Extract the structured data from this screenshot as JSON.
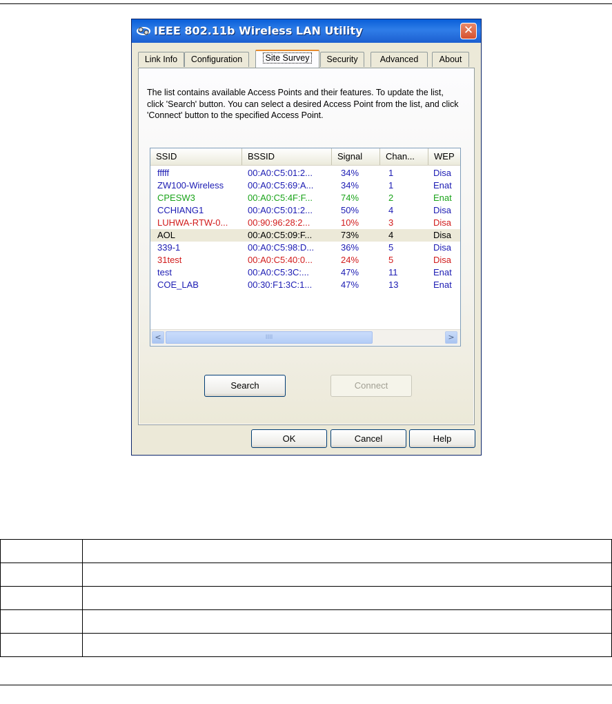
{
  "window": {
    "title": "IEEE 802.11b Wireless LAN Utility",
    "close_glyph": "✕"
  },
  "tabs": [
    {
      "label": "Link Info"
    },
    {
      "label": "Configuration"
    },
    {
      "label": "Site Survey"
    },
    {
      "label": "Security"
    },
    {
      "label": "Advanced"
    },
    {
      "label": "About"
    }
  ],
  "site_survey": {
    "description": "The list contains available Access Points and their features. To update the list, click 'Search' button. You can select a desired Access Point from the list, and click 'Connect' button to the specified Access Point.",
    "columns": [
      "SSID",
      "BSSID",
      "Signal",
      "Chan...",
      "WEP"
    ],
    "rows": [
      {
        "ssid": "fffff",
        "bssid": "00:A0:C5:01:2...",
        "signal": "34%",
        "channel": "1",
        "wep": "Disa",
        "color": "#1b1bb3"
      },
      {
        "ssid": "ZW100-Wireless",
        "bssid": "00:A0:C5:69:A...",
        "signal": "34%",
        "channel": "1",
        "wep": "Enat",
        "color": "#1b1bb3"
      },
      {
        "ssid": "CPESW3",
        "bssid": "00:A0:C5:4F:F...",
        "signal": "74%",
        "channel": "2",
        "wep": "Enat",
        "color": "#19a319"
      },
      {
        "ssid": "CCHIANG1",
        "bssid": "00:A0:C5:01:2...",
        "signal": "50%",
        "channel": "4",
        "wep": "Disa",
        "color": "#1b1bb3"
      },
      {
        "ssid": "LUHWA-RTW-0...",
        "bssid": "00:90:96:28:2...",
        "signal": "10%",
        "channel": "3",
        "wep": "Disa",
        "color": "#d11b1b"
      },
      {
        "ssid": "AOL",
        "bssid": "00:A0:C5:09:F...",
        "signal": "73%",
        "channel": "4",
        "wep": "Disa",
        "color": "#000000"
      },
      {
        "ssid": "339-1",
        "bssid": "00:A0:C5:98:D...",
        "signal": "36%",
        "channel": "5",
        "wep": "Disa",
        "color": "#1b1bb3"
      },
      {
        "ssid": "31test",
        "bssid": "00:A0:C5:40:0...",
        "signal": "24%",
        "channel": "5",
        "wep": "Disa",
        "color": "#d11b1b"
      },
      {
        "ssid": "test",
        "bssid": "00:A0:C5:3C:...",
        "signal": "47%",
        "channel": "11",
        "wep": "Enat",
        "color": "#1b1bb3"
      },
      {
        "ssid": "COE_LAB",
        "bssid": "00:30:F1:3C:1...",
        "signal": "47%",
        "channel": "13",
        "wep": "Enat",
        "color": "#1b1bb3"
      }
    ],
    "scroll_left": "<",
    "scroll_right": ">",
    "scroll_grip": "IIII",
    "search_label": "Search",
    "connect_label": "Connect"
  },
  "footer": {
    "ok_label": "OK",
    "cancel_label": "Cancel",
    "help_label": "Help"
  },
  "doc_table": {
    "rows": 5
  }
}
